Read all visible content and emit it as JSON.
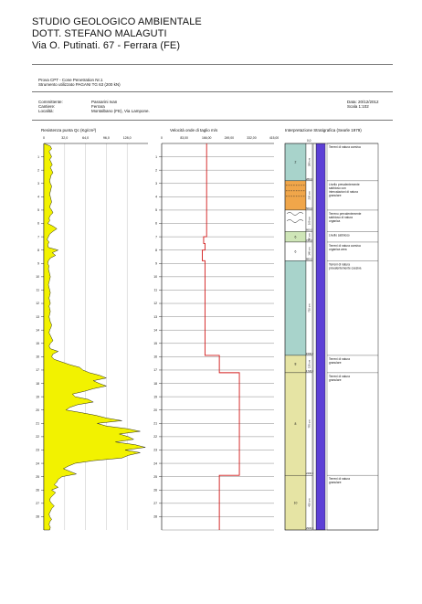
{
  "header": {
    "company": "STUDIO GEOLOGICO AMBIENTALE",
    "person": "DOTT. STEFANO MALAGUTI",
    "address": "Via O. Putinati. 67 - Ferrara (FE)"
  },
  "test": {
    "line1": "Prova CPT - Cone Penetration Nr.1",
    "line2": "Strumento utilizzato PAGANI TG 63 (200 kN)"
  },
  "info": {
    "committente_label": "Committente:",
    "committente": "Passarini Ivan",
    "cantiere_label": "Cantiere:",
    "cantiere": "Ferrara",
    "localita_label": "Località:",
    "localita": "Montalbano (FE), Via Lampone.",
    "data_label": "Data: 20/12/2012",
    "scala_label": "Scala 1:102"
  },
  "chart_data": [
    {
      "type": "area",
      "title": "Resistenza punta Qc (Kg/cm²)",
      "x_ticks": [
        "0",
        "32,0",
        "64,0",
        "96,0",
        "128,0"
      ],
      "xlim": [
        0,
        160
      ],
      "depth_ticks": [
        "1",
        "2",
        "3",
        "4",
        "5",
        "6",
        "7",
        "8",
        "9",
        "10",
        "11",
        "12",
        "13",
        "14",
        "15",
        "16",
        "17",
        "18",
        "19",
        "20",
        "21",
        "22",
        "23",
        "24",
        "25",
        "26",
        "27",
        "28"
      ],
      "depth_m": [
        0,
        0.2,
        0.4,
        0.6,
        0.8,
        1.0,
        1.2,
        1.4,
        1.6,
        1.8,
        2.0,
        2.2,
        2.4,
        2.6,
        2.8,
        3.0,
        3.2,
        3.4,
        3.6,
        3.8,
        4.0,
        4.2,
        4.4,
        4.6,
        4.8,
        5.0,
        5.2,
        5.4,
        5.6,
        5.8,
        6.0,
        6.2,
        6.4,
        6.6,
        6.8,
        7.0,
        7.2,
        7.4,
        7.6,
        7.8,
        8.0,
        8.2,
        8.4,
        8.6,
        8.8,
        9.0,
        9.2,
        9.4,
        9.6,
        9.8,
        10.0,
        10.2,
        10.4,
        10.6,
        10.8,
        11.0,
        11.2,
        11.4,
        11.6,
        11.8,
        12.0,
        12.2,
        12.4,
        12.6,
        12.8,
        13.0,
        13.2,
        13.4,
        13.6,
        13.8,
        14.0,
        14.2,
        14.4,
        14.6,
        14.8,
        15.0,
        15.2,
        15.4,
        15.6,
        15.8,
        16.0,
        16.2,
        16.4,
        16.6,
        16.8,
        17.0,
        17.2,
        17.4,
        17.6,
        17.8,
        18.0,
        18.2,
        18.4,
        18.6,
        18.8,
        19.0,
        19.2,
        19.4,
        19.6,
        19.8,
        20.0,
        20.2,
        20.4,
        20.6,
        20.8,
        21.0,
        21.2,
        21.4,
        21.6,
        21.8,
        22.0,
        22.2,
        22.4,
        22.6,
        22.8,
        23.0,
        23.2,
        23.4,
        23.6,
        23.8,
        24.0,
        24.2,
        24.4,
        24.6,
        24.8,
        25.0,
        25.2,
        25.4,
        25.6,
        25.8,
        26.0,
        26.2,
        26.4,
        26.6,
        26.8,
        27.0,
        27.2,
        27.4,
        27.6,
        27.8,
        28.0,
        28.2,
        28.4,
        28.6,
        28.8,
        29.0
      ],
      "qc": [
        0,
        10,
        12,
        8,
        10,
        12,
        9,
        11,
        13,
        10,
        12,
        14,
        11,
        10,
        9,
        10,
        12,
        11,
        10,
        9,
        10,
        11,
        12,
        10,
        9,
        12,
        14,
        10,
        8,
        9,
        6,
        14,
        20,
        14,
        9,
        7,
        5,
        8,
        6,
        7,
        22,
        13,
        18,
        10,
        7,
        6,
        8,
        7,
        8,
        9,
        10,
        9,
        8,
        7,
        8,
        9,
        10,
        9,
        8,
        9,
        10,
        8,
        9,
        10,
        9,
        8,
        9,
        10,
        12,
        11,
        9,
        8,
        10,
        12,
        14,
        10,
        8,
        10,
        22,
        14,
        12,
        16,
        28,
        40,
        55,
        60,
        70,
        86,
        96,
        76,
        85,
        96,
        76,
        62,
        44,
        48,
        68,
        76,
        52,
        40,
        34,
        58,
        80,
        96,
        120,
        82,
        96,
        128,
        148,
        116,
        130,
        138,
        110,
        140,
        156,
        125,
        148,
        130,
        120,
        76,
        48,
        38,
        30,
        40,
        50,
        28,
        22,
        20,
        16,
        22,
        12,
        18,
        14,
        10,
        9,
        12,
        16,
        12,
        10,
        8,
        9,
        12,
        9,
        8,
        10,
        9
      ]
    },
    {
      "type": "line",
      "title": "Velocità onde di taglio m/s",
      "x_ticks": [
        "0",
        "83,00",
        "166,00",
        "249,00",
        "332,00",
        "415,00"
      ],
      "xlim": [
        0,
        415
      ],
      "vs_steps": [
        [
          0,
          166
        ],
        [
          7.0,
          155
        ],
        [
          7.5,
          160
        ],
        [
          8.0,
          150
        ],
        [
          8.8,
          160
        ],
        [
          15.9,
          213
        ],
        [
          17.2,
          287
        ],
        [
          24.9,
          213
        ],
        [
          29.0,
          213
        ]
      ]
    }
  ],
  "strat": {
    "title": "Interpretazione Stratigrafica (Searle 1979)",
    "depth_top_label": "0,0",
    "layers": [
      {
        "top": 0.0,
        "bottom": 2.8,
        "color": "#a8d3cb",
        "num": "2",
        "thk": "280 cm",
        "base": "280,0",
        "desc": [
          "Terreni di natura coesiva"
        ]
      },
      {
        "top": 2.8,
        "bottom": 5.0,
        "color": "#f0a64a",
        "num": "",
        "thk": "220 cm",
        "base": "500,0",
        "desc": [
          "Livello prevalentemente",
          "sabbioso con",
          "intercalazioni di natura",
          "granulare"
        ]
      },
      {
        "top": 5.0,
        "bottom": 6.6,
        "color": "#ffffff",
        "num": "",
        "thk": "160 cm",
        "base": "660,0",
        "desc": [
          "Terreno prevalentemente",
          "sabbioso di natura",
          "organica"
        ]
      },
      {
        "top": 6.6,
        "bottom": 7.4,
        "color": "#cfe6b8",
        "num": "6",
        "thk": "80 cm",
        "base": "740,0",
        "desc": [
          "Livello sabbioso"
        ]
      },
      {
        "top": 7.4,
        "bottom": 8.8,
        "color": "#ffffff",
        "num": "6",
        "thk": "140 cm",
        "base": "880,0",
        "desc": [
          "Terreni di natura coesiva",
          "organica area"
        ]
      },
      {
        "top": 8.8,
        "bottom": 15.9,
        "color": "#a8d3cb",
        "num": "",
        "thk": "710 cm",
        "base": "1590,0",
        "desc": [
          "Terreni di natura",
          "prevalentemente coesiva"
        ]
      },
      {
        "top": 15.9,
        "bottom": 17.2,
        "color": "#e6e4a4",
        "num": "8",
        "thk": "130 cm",
        "base": "1720,0",
        "desc": [
          "Terreni di natura",
          "granulare"
        ]
      },
      {
        "top": 17.2,
        "bottom": 24.9,
        "color": "#e6e4a4",
        "num": "8",
        "thk": "770 cm",
        "base": "2490,0",
        "desc": [
          "Terreni di natura",
          "granulare"
        ]
      },
      {
        "top": 24.9,
        "bottom": 29.0,
        "color": "#e6e4a4",
        "num": "10",
        "thk": "410 cm",
        "base": "2900,0",
        "desc": [
          "Terreni di natura",
          "granulare"
        ]
      }
    ]
  },
  "colors": {
    "qc_fill": "#f2f200",
    "vs_line": "#d21a1a",
    "purple_col": "#5c3fd6",
    "grid": "#000"
  }
}
